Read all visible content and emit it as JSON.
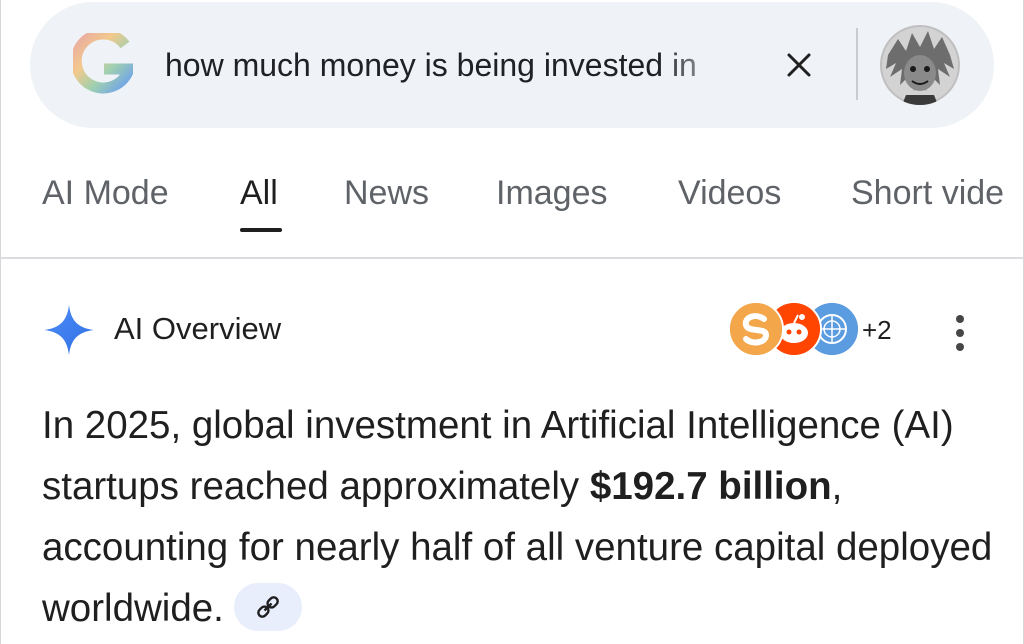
{
  "search": {
    "query": "how much money is being invested in",
    "clear_icon": "close-icon",
    "avatar": "user-avatar-photo"
  },
  "tabs": [
    {
      "label": "AI Mode",
      "active": false
    },
    {
      "label": "All",
      "active": true
    },
    {
      "label": "News",
      "active": false
    },
    {
      "label": "Images",
      "active": false
    },
    {
      "label": "Videos",
      "active": false
    },
    {
      "label": "Short vide",
      "active": false
    }
  ],
  "ai_overview": {
    "title": "AI Overview",
    "icon": "sparkle-icon",
    "sources_more": "+2",
    "menu_icon": "more-vert-icon",
    "answer": {
      "part1": "In 2025, global investment in Artificial Intelligence (AI) startups reached approximately ",
      "bold": "$192.7 billion",
      "part2": ", accounting for nearly half of all venture capital deployed worldwide.",
      "link_icon": "link-icon"
    }
  },
  "colors": {
    "search_bg": "#eff2f6",
    "link_chip_bg": "#e8eefc",
    "sparkle": "#4285f4",
    "tab_inactive": "#5f6368"
  }
}
